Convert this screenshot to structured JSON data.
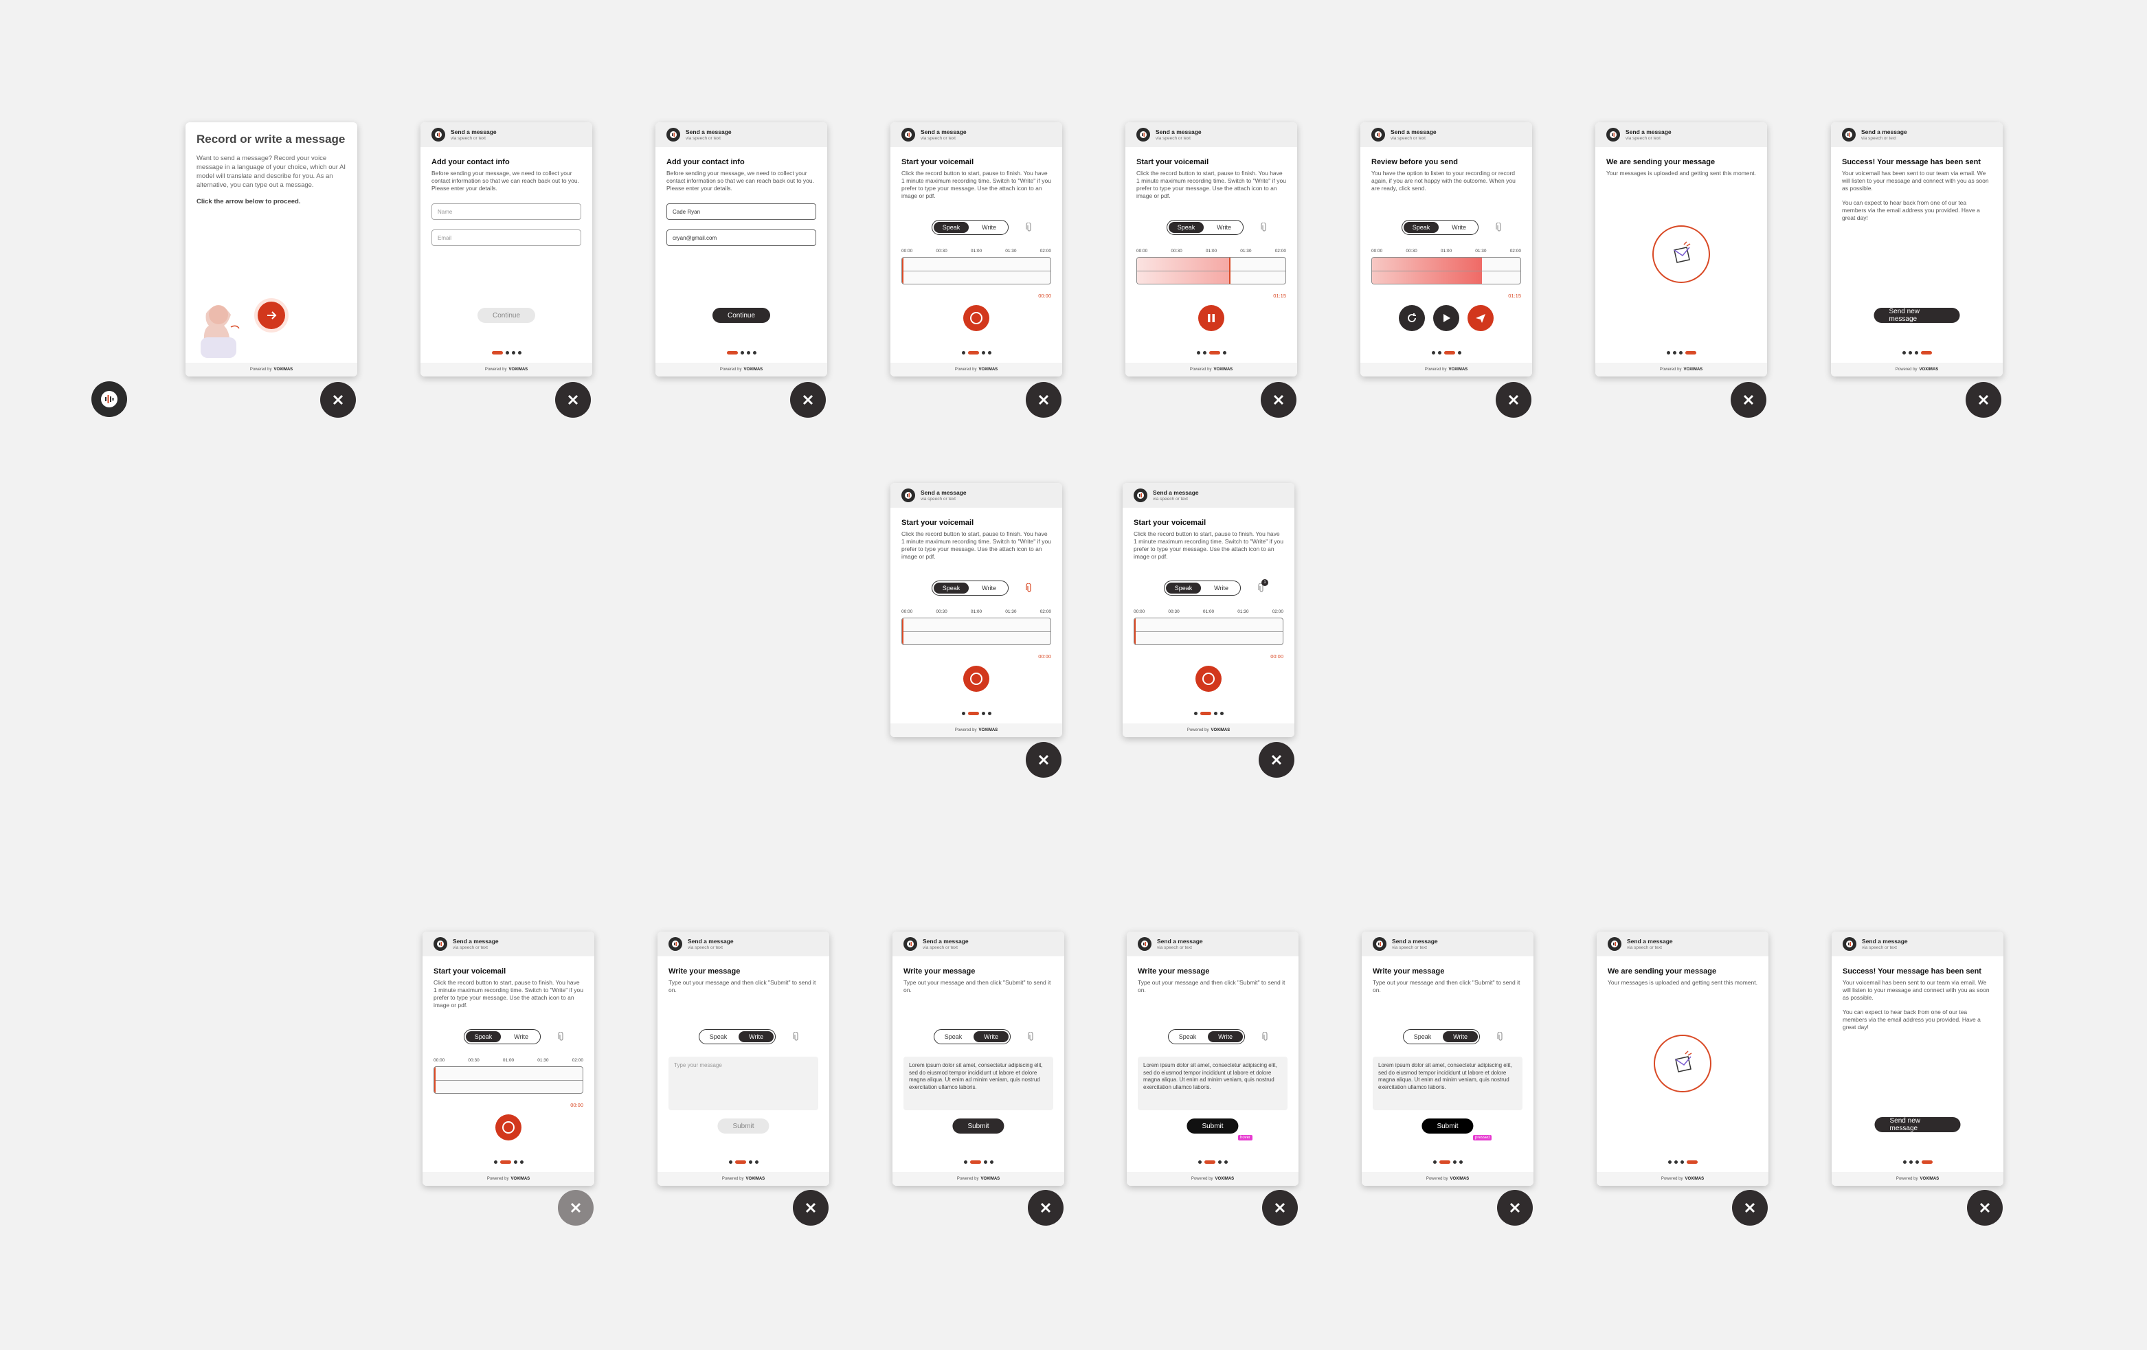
{
  "header": {
    "title": "Send a message",
    "subtitle": "via speech or text"
  },
  "footer": {
    "powered": "Powered by",
    "brand": "VOXIMAS"
  },
  "intro": {
    "title": "Record or write a message",
    "desc": "Want to send a message? Record your voice message in a language of your choice, which our AI model will translate and describe for you. As an alternative, you can type out a message.",
    "cta": "Click the arrow below to proceed."
  },
  "contact": {
    "title": "Add your contact info",
    "desc": "Before sending your message, we need to collect your contact information so that we can reach back out to you. Please enter your details.",
    "name_placeholder": "Name",
    "email_placeholder": "Email",
    "name_value": "Cade Ryan",
    "email_value": "cryan@gmail.com",
    "continue": "Continue"
  },
  "voicemail": {
    "title": "Start your voicemail",
    "desc": "Click the record button to start, pause to finish. You have 1 minute maximum recording time. Switch to \"Write\" if you prefer to type your message. Use the attach icon to an image or pdf.",
    "ticks": [
      "00:00",
      "00:30",
      "01:00",
      "01:30",
      "02:00"
    ],
    "time_start": "00:00",
    "time_end": "01:15"
  },
  "toggle": {
    "speak": "Speak",
    "write": "Write"
  },
  "review": {
    "title": "Review before you send",
    "desc": "You have the option to listen to your recording or record again, if you are not happy with the outcome. When you are ready, click send."
  },
  "sending": {
    "title": "We are sending your message",
    "desc": "Your messages is uploaded and getting sent this moment."
  },
  "success": {
    "title": "Success! Your message has been sent",
    "desc1": "Your voicemail has been sent to our team via email. We will listen to your message and connect with you as soon as possible.",
    "desc2": "You can expect to hear back from one of our tea members via the email address you provided. Have a great day!",
    "button": "Send new message"
  },
  "write": {
    "title": "Write your message",
    "desc": "Type out your message and then click \"Submit\" to send it on.",
    "placeholder": "Type your message",
    "lorem": "Lorem ipsum dolor sit amet, consectetur adipiscing elit, sed do eiusmod tempor incididunt ut labore et dolore magna aliqua. Ut enim ad minim veniam, quis nostrud exercitation ullamco laboris.",
    "submit": "Submit",
    "hover_tag": "hover",
    "pressed_tag": "pressed"
  },
  "attach_badge": "1"
}
